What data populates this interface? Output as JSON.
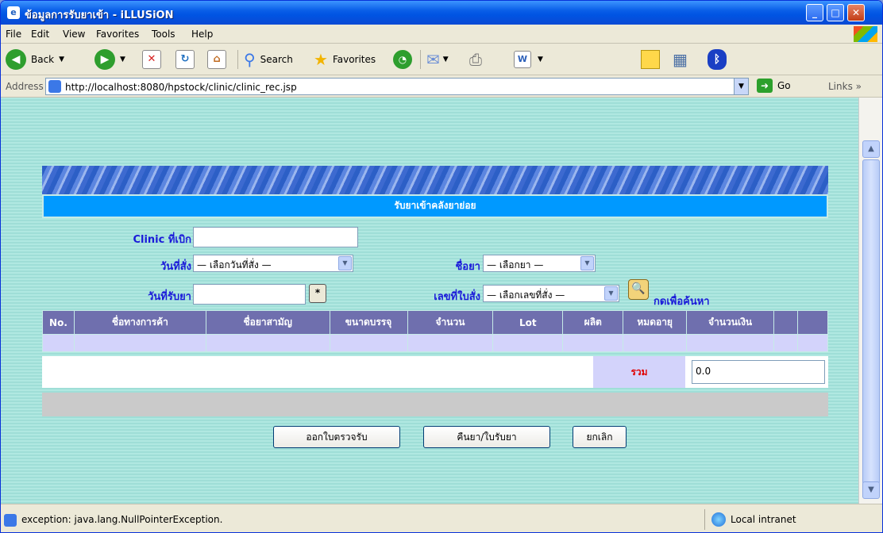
{
  "window": {
    "title": "ข้อมูลการรับยาเข้า - iLLUSiON"
  },
  "menu": [
    "File",
    "Edit",
    "View",
    "Favorites",
    "Tools",
    "Help"
  ],
  "toolbar": {
    "back": "Back",
    "search": "Search",
    "favorites": "Favorites"
  },
  "address": {
    "label": "Address",
    "url": "http://localhost:8080/hpstock/clinic/clinic_rec.jsp",
    "go": "Go",
    "links": "Links"
  },
  "page": {
    "heading": "รับยาเข้าคลังยาย่อย",
    "labels": {
      "clinic": "Clinic ที่เบิก",
      "order_date": "วันที่สั่ง",
      "receive_date": "วันที่รับยา",
      "drug_name": "ชื่อยา",
      "order_no": "เลขที่ใบสั่ง"
    },
    "selects": {
      "order_date": "— เลือกวันที่สั่ง —",
      "drug_name": "— เลือกยา —",
      "order_no": "— เลือกเลขที่สั่ง —"
    },
    "star": "*",
    "search_link": "กดเพื่อค้นหา",
    "columns": [
      "No.",
      "ชื่อทางการค้า",
      "ชื่อยาสามัญ",
      "ขนาดบรรจุ",
      "จำนวน",
      "Lot",
      "ผลิต",
      "หมดอายุ",
      "จำนวนเงิน",
      "",
      ""
    ],
    "total_label": "รวม",
    "total_value": "0.0",
    "buttons": {
      "inspect": "ออกใบตรวจรับ",
      "return": "คืนยา/ใบรับยา",
      "cancel": "ยกเลิก"
    }
  },
  "status": {
    "text": "exception: java.lang.NullPointerException.",
    "zone": "Local intranet"
  }
}
